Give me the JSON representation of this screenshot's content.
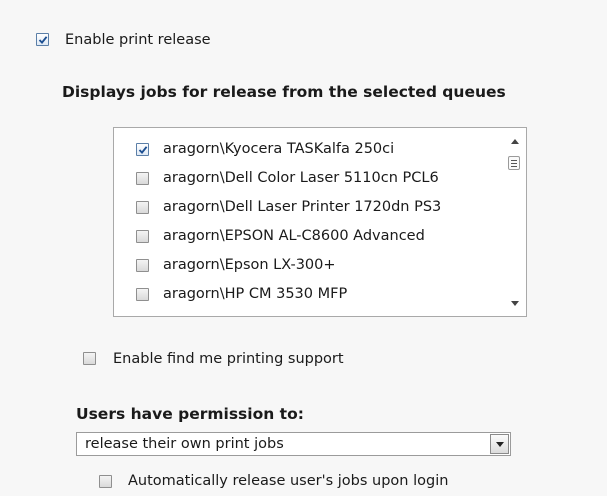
{
  "enable_print_release": {
    "label": "Enable print release",
    "checked": true
  },
  "queues_section": {
    "heading": "Displays jobs for release from the selected queues",
    "items": [
      {
        "label": "aragorn\\Kyocera TASKalfa 250ci",
        "checked": true
      },
      {
        "label": "aragorn\\Dell Color Laser 5110cn PCL6",
        "checked": false
      },
      {
        "label": "aragorn\\Dell Laser Printer 1720dn PS3",
        "checked": false
      },
      {
        "label": "aragorn\\EPSON AL-C8600 Advanced",
        "checked": false
      },
      {
        "label": "aragorn\\Epson LX-300+",
        "checked": false
      },
      {
        "label": "aragorn\\HP CM 3530 MFP",
        "checked": false
      }
    ]
  },
  "find_me_printing": {
    "label": "Enable find me printing support",
    "checked": false
  },
  "permissions": {
    "heading": "Users have permission to:",
    "selected_value": "release their own print jobs"
  },
  "auto_release": {
    "label": "Automatically release user's jobs upon login",
    "checked": false
  },
  "colors": {
    "background": "#f7f7f7",
    "check_tick": "#1d4f91"
  }
}
